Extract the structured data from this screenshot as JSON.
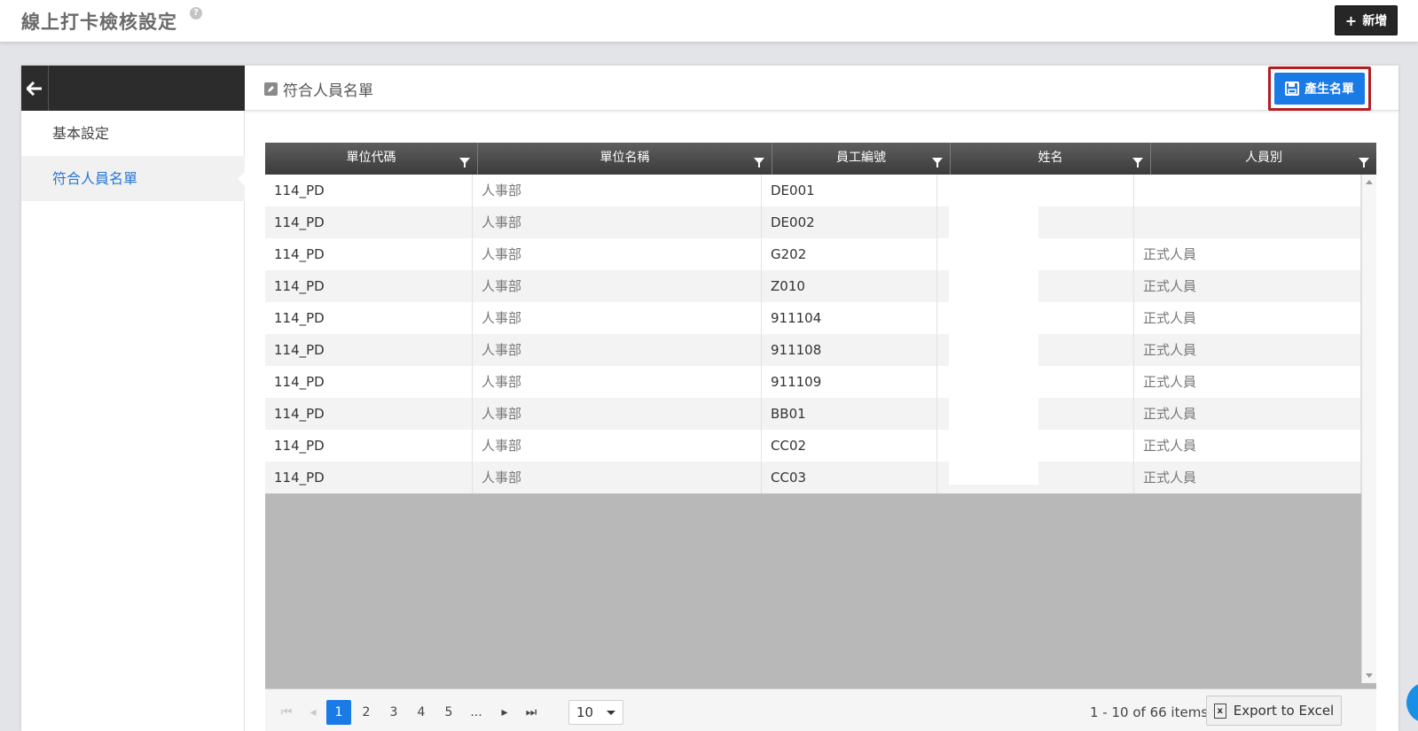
{
  "header": {
    "title": "線上打卡檢核設定",
    "help_icon": "?",
    "add_button": "新增",
    "add_icon": "+"
  },
  "sidebar": {
    "back_icon": "arrow-left-icon",
    "items": [
      {
        "label": "基本設定"
      },
      {
        "label": "符合人員名單"
      }
    ]
  },
  "content": {
    "section_title": "符合人員名單",
    "generate_button": "產生名單"
  },
  "table": {
    "columns": [
      "單位代碼",
      "單位名稱",
      "員工編號",
      "姓名",
      "人員別"
    ],
    "rows": [
      {
        "unit_code": "114_PD",
        "unit_name": "人事部",
        "emp_id": "DE001",
        "name": "",
        "type": ""
      },
      {
        "unit_code": "114_PD",
        "unit_name": "人事部",
        "emp_id": "DE002",
        "name": "",
        "type": ""
      },
      {
        "unit_code": "114_PD",
        "unit_name": "人事部",
        "emp_id": "G202",
        "name": "",
        "type": "正式人員"
      },
      {
        "unit_code": "114_PD",
        "unit_name": "人事部",
        "emp_id": "Z010",
        "name": "",
        "type": "正式人員"
      },
      {
        "unit_code": "114_PD",
        "unit_name": "人事部",
        "emp_id": "911104",
        "name": "",
        "type": "正式人員"
      },
      {
        "unit_code": "114_PD",
        "unit_name": "人事部",
        "emp_id": "911108",
        "name": "",
        "type": "正式人員"
      },
      {
        "unit_code": "114_PD",
        "unit_name": "人事部",
        "emp_id": "911109",
        "name": "",
        "type": "正式人員"
      },
      {
        "unit_code": "114_PD",
        "unit_name": "人事部",
        "emp_id": "BB01",
        "name": "",
        "type": "正式人員"
      },
      {
        "unit_code": "114_PD",
        "unit_name": "人事部",
        "emp_id": "CC02",
        "name": "",
        "type": "正式人員"
      },
      {
        "unit_code": "114_PD",
        "unit_name": "人事部",
        "emp_id": "CC03",
        "name": "",
        "type": "正式人員"
      }
    ]
  },
  "pager": {
    "pages": [
      "1",
      "2",
      "3",
      "4",
      "5",
      "..."
    ],
    "current_page": "1",
    "page_size": "10",
    "info": "1 - 10 of 66 items",
    "export_label": "Export to Excel",
    "export_icon": "x"
  },
  "colors": {
    "accent": "#1a7ae6",
    "highlight_border": "#b41e23",
    "header_dark": "#2c2c2c"
  }
}
